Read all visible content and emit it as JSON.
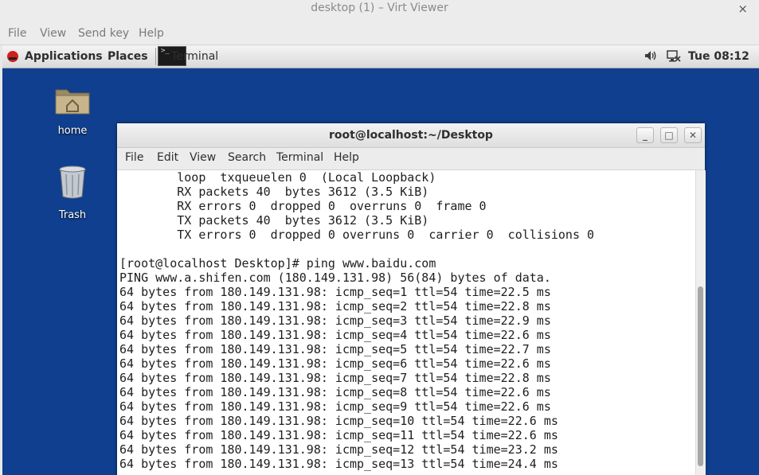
{
  "window": {
    "title": "desktop (1) – Virt Viewer",
    "close": "×"
  },
  "menubar": [
    "File",
    "View",
    "Send key",
    "Help"
  ],
  "panel": {
    "applications": "Applications",
    "places": "Places",
    "task_label": "Terminal",
    "task_icon_text": ">_",
    "clock": "Tue 08:12"
  },
  "desktop_icons": {
    "home": "home",
    "trash": "Trash"
  },
  "terminal": {
    "title": "root@localhost:~/Desktop",
    "buttons": {
      "minimize": "_",
      "maximize": "□",
      "close": "✕"
    },
    "menu": [
      "File",
      "Edit",
      "View",
      "Search",
      "Terminal",
      "Help"
    ],
    "lines": [
      "        loop  txqueuelen 0  (Local Loopback)",
      "        RX packets 40  bytes 3612 (3.5 KiB)",
      "        RX errors 0  dropped 0  overruns 0  frame 0",
      "        TX packets 40  bytes 3612 (3.5 KiB)",
      "        TX errors 0  dropped 0 overruns 0  carrier 0  collisions 0",
      "",
      "[root@localhost Desktop]# ping www.baidu.com",
      "PING www.a.shifen.com (180.149.131.98) 56(84) bytes of data.",
      "64 bytes from 180.149.131.98: icmp_seq=1 ttl=54 time=22.5 ms",
      "64 bytes from 180.149.131.98: icmp_seq=2 ttl=54 time=22.8 ms",
      "64 bytes from 180.149.131.98: icmp_seq=3 ttl=54 time=22.9 ms",
      "64 bytes from 180.149.131.98: icmp_seq=4 ttl=54 time=22.6 ms",
      "64 bytes from 180.149.131.98: icmp_seq=5 ttl=54 time=22.7 ms",
      "64 bytes from 180.149.131.98: icmp_seq=6 ttl=54 time=22.6 ms",
      "64 bytes from 180.149.131.98: icmp_seq=7 ttl=54 time=22.8 ms",
      "64 bytes from 180.149.131.98: icmp_seq=8 ttl=54 time=22.6 ms",
      "64 bytes from 180.149.131.98: icmp_seq=9 ttl=54 time=22.6 ms",
      "64 bytes from 180.149.131.98: icmp_seq=10 ttl=54 time=22.6 ms",
      "64 bytes from 180.149.131.98: icmp_seq=11 ttl=54 time=22.6 ms",
      "64 bytes from 180.149.131.98: icmp_seq=12 ttl=54 time=23.2 ms",
      "64 bytes from 180.149.131.98: icmp_seq=13 ttl=54 time=24.4 ms"
    ]
  },
  "colors": {
    "desktop_bg": "#0f3f8e",
    "panel_bg": "#e4e4e4",
    "redhat_red": "#d0201b",
    "terminal_bg": "#ffffff",
    "terminal_fg": "#1e1e1e"
  },
  "icons": [
    "close-icon",
    "redhat-logo-icon",
    "terminal-icon",
    "volume-icon",
    "network-icon",
    "folder-home-icon",
    "trash-icon",
    "minimize-icon",
    "maximize-icon"
  ]
}
